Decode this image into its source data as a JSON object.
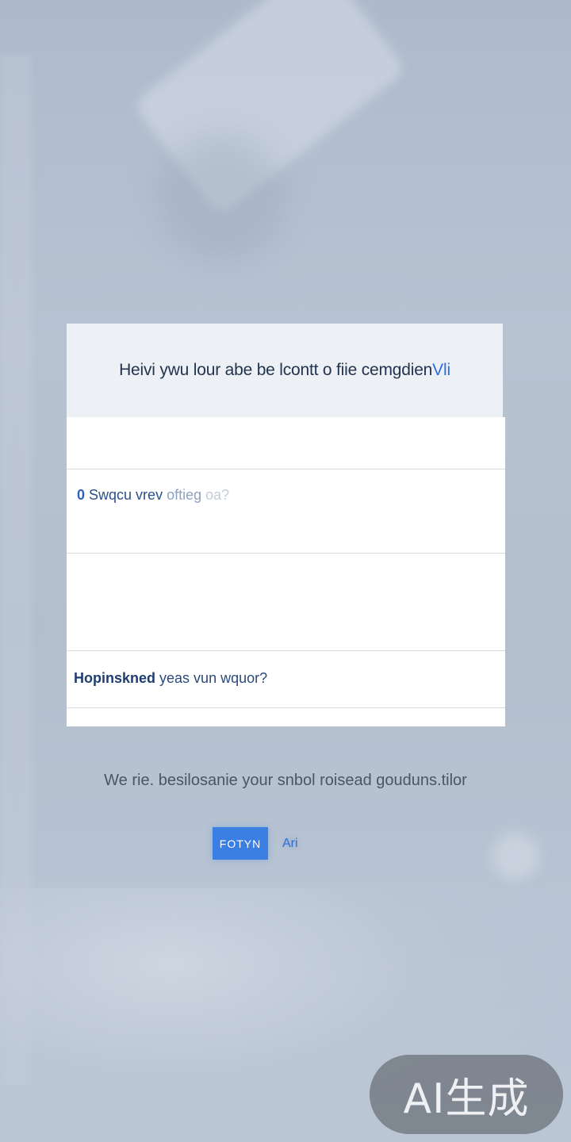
{
  "dialog": {
    "title": "Heivi ywu lour abe be lcontt o fiie cemgdien",
    "title_accent": "Vli",
    "options": [
      {
        "number": "0",
        "label": "Swqcu vrev",
        "hint": "oftieg",
        "hint_extra": "oa?"
      }
    ],
    "question": "Hopinskned",
    "question_rest": "yeas vun wquor?"
  },
  "footer": {
    "description": "We rie.  besilosanie your snbol roisead  gouduns.tilor",
    "primary_button": "FOTYN",
    "secondary_button": "Ari"
  },
  "watermark": {
    "text": "AI生成"
  }
}
